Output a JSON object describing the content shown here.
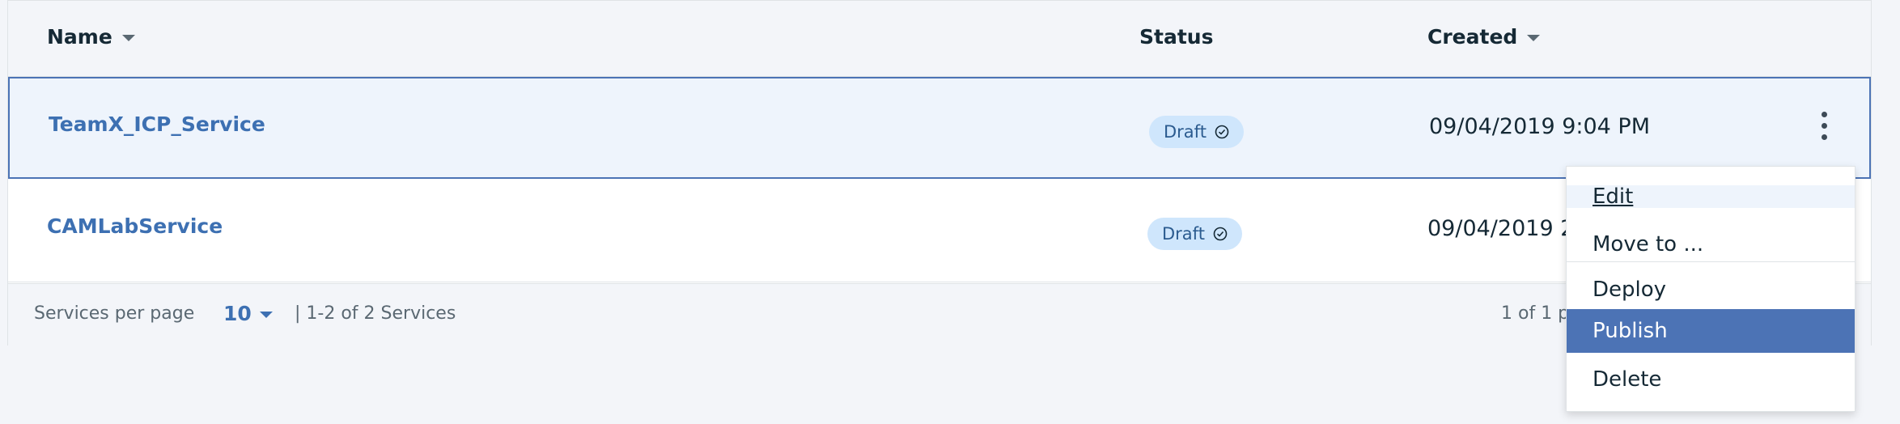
{
  "table": {
    "headers": {
      "name": "Name",
      "status": "Status",
      "created": "Created"
    },
    "rows": [
      {
        "name": "TeamX_ICP_Service",
        "status": "Draft",
        "created": "09/04/2019 9:04 PM"
      },
      {
        "name": "CAMLabService",
        "status": "Draft",
        "created": "09/04/2019 2"
      }
    ]
  },
  "pagination": {
    "per_page_label": "Services per page",
    "per_page_value": "10",
    "range": "| 1-2 of 2 Services",
    "pages": "1 of 1 p"
  },
  "overflow_menu": {
    "items": [
      "Edit",
      "Move to ...",
      "Deploy",
      "Publish",
      "Delete"
    ]
  },
  "colors": {
    "link": "#3d70b2",
    "badge_bg": "#cfe6fc",
    "menu_active": "#4c73b5",
    "selected_row_border": "#4c73b5"
  }
}
